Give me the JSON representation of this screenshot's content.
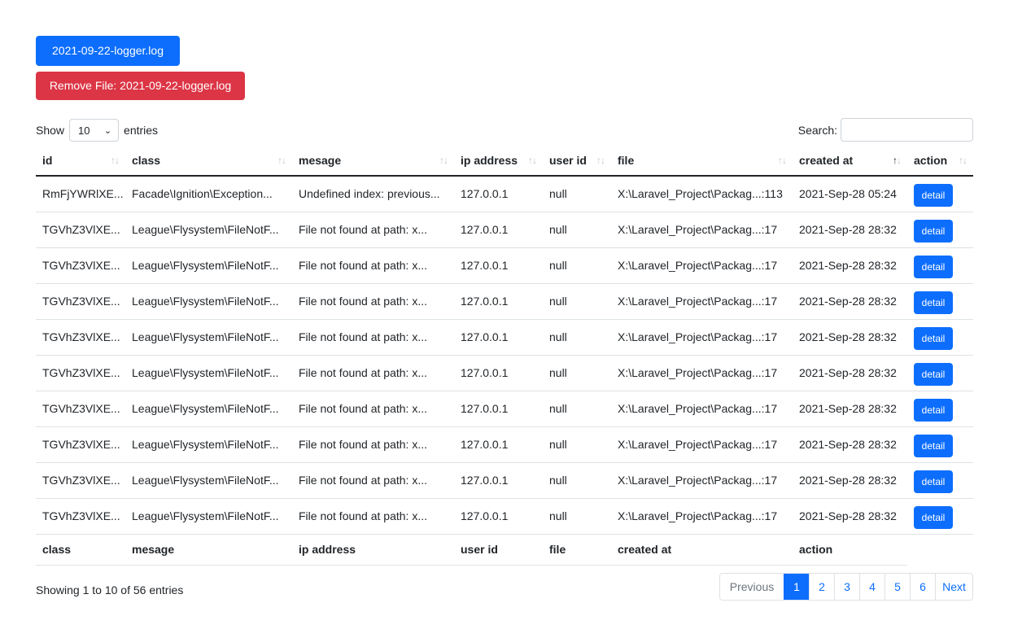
{
  "file_button": "2021-09-22-logger.log",
  "remove_button": "Remove File: 2021-09-22-logger.log",
  "length": {
    "show": "Show",
    "value": "10",
    "entries": "entries"
  },
  "search": {
    "label": "Search:",
    "value": ""
  },
  "columns": [
    "id",
    "class",
    "mesage",
    "ip address",
    "user id",
    "file",
    "created at",
    "action"
  ],
  "rows": [
    {
      "id": "RmFjYWRlXE...",
      "class": "Facade\\Ignition\\Exception...",
      "message": "Undefined index: previous...",
      "ip": "127.0.0.1",
      "user_id": "null",
      "file": "X:\\Laravel_Project\\Packag...:113",
      "created_at": "2021-Sep-28 05:24",
      "action": "detail"
    },
    {
      "id": "TGVhZ3VlXE...",
      "class": "League\\Flysystem\\FileNotF...",
      "message": "File not found at path: x...",
      "ip": "127.0.0.1",
      "user_id": "null",
      "file": "X:\\Laravel_Project\\Packag...:17",
      "created_at": "2021-Sep-28 28:32",
      "action": "detail"
    },
    {
      "id": "TGVhZ3VlXE...",
      "class": "League\\Flysystem\\FileNotF...",
      "message": "File not found at path: x...",
      "ip": "127.0.0.1",
      "user_id": "null",
      "file": "X:\\Laravel_Project\\Packag...:17",
      "created_at": "2021-Sep-28 28:32",
      "action": "detail"
    },
    {
      "id": "TGVhZ3VlXE...",
      "class": "League\\Flysystem\\FileNotF...",
      "message": "File not found at path: x...",
      "ip": "127.0.0.1",
      "user_id": "null",
      "file": "X:\\Laravel_Project\\Packag...:17",
      "created_at": "2021-Sep-28 28:32",
      "action": "detail"
    },
    {
      "id": "TGVhZ3VlXE...",
      "class": "League\\Flysystem\\FileNotF...",
      "message": "File not found at path: x...",
      "ip": "127.0.0.1",
      "user_id": "null",
      "file": "X:\\Laravel_Project\\Packag...:17",
      "created_at": "2021-Sep-28 28:32",
      "action": "detail"
    },
    {
      "id": "TGVhZ3VlXE...",
      "class": "League\\Flysystem\\FileNotF...",
      "message": "File not found at path: x...",
      "ip": "127.0.0.1",
      "user_id": "null",
      "file": "X:\\Laravel_Project\\Packag...:17",
      "created_at": "2021-Sep-28 28:32",
      "action": "detail"
    },
    {
      "id": "TGVhZ3VlXE...",
      "class": "League\\Flysystem\\FileNotF...",
      "message": "File not found at path: x...",
      "ip": "127.0.0.1",
      "user_id": "null",
      "file": "X:\\Laravel_Project\\Packag...:17",
      "created_at": "2021-Sep-28 28:32",
      "action": "detail"
    },
    {
      "id": "TGVhZ3VlXE...",
      "class": "League\\Flysystem\\FileNotF...",
      "message": "File not found at path: x...",
      "ip": "127.0.0.1",
      "user_id": "null",
      "file": "X:\\Laravel_Project\\Packag...:17",
      "created_at": "2021-Sep-28 28:32",
      "action": "detail"
    },
    {
      "id": "TGVhZ3VlXE...",
      "class": "League\\Flysystem\\FileNotF...",
      "message": "File not found at path: x...",
      "ip": "127.0.0.1",
      "user_id": "null",
      "file": "X:\\Laravel_Project\\Packag...:17",
      "created_at": "2021-Sep-28 28:32",
      "action": "detail"
    },
    {
      "id": "TGVhZ3VlXE...",
      "class": "League\\Flysystem\\FileNotF...",
      "message": "File not found at path: x...",
      "ip": "127.0.0.1",
      "user_id": "null",
      "file": "X:\\Laravel_Project\\Packag...:17",
      "created_at": "2021-Sep-28 28:32",
      "action": "detail"
    }
  ],
  "footer_columns": [
    "class",
    "mesage",
    "ip address",
    "user id",
    "file",
    "created at",
    "action"
  ],
  "info": "Showing 1 to 10 of 56 entries",
  "pagination": {
    "previous": "Previous",
    "pages": [
      "1",
      "2",
      "3",
      "4",
      "5",
      "6"
    ],
    "active": "1",
    "next": "Next"
  },
  "sort_icons": "up-down-arrows-icon",
  "colors": {
    "primary": "#0d6efd",
    "danger": "#dc3545"
  }
}
